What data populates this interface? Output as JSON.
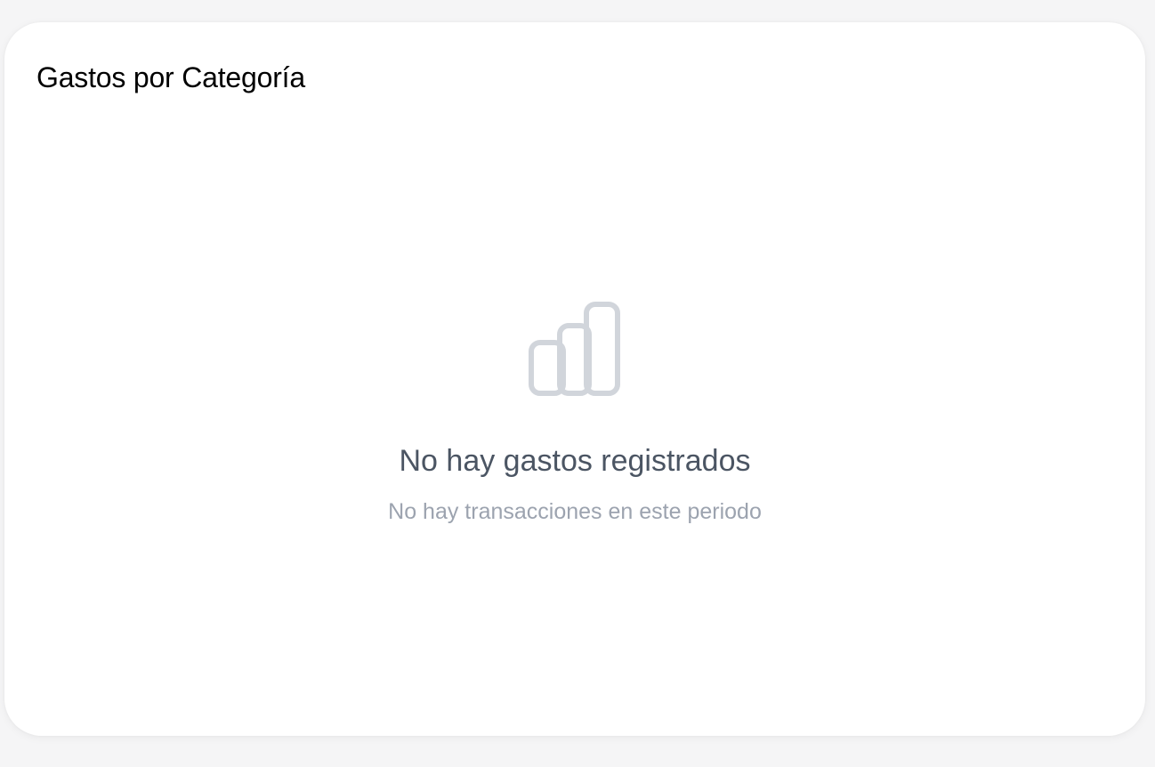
{
  "card": {
    "title": "Gastos por Categoría"
  },
  "empty_state": {
    "icon": "bar-chart-icon",
    "heading": "No hay gastos registrados",
    "subtext": "No hay transacciones en este periodo"
  },
  "colors": {
    "page_background": "#f5f5f6",
    "card_background": "#ffffff",
    "title": "#000000",
    "heading": "#4b5563",
    "subtext": "#9ca3af",
    "icon_stroke": "#d1d5db"
  }
}
